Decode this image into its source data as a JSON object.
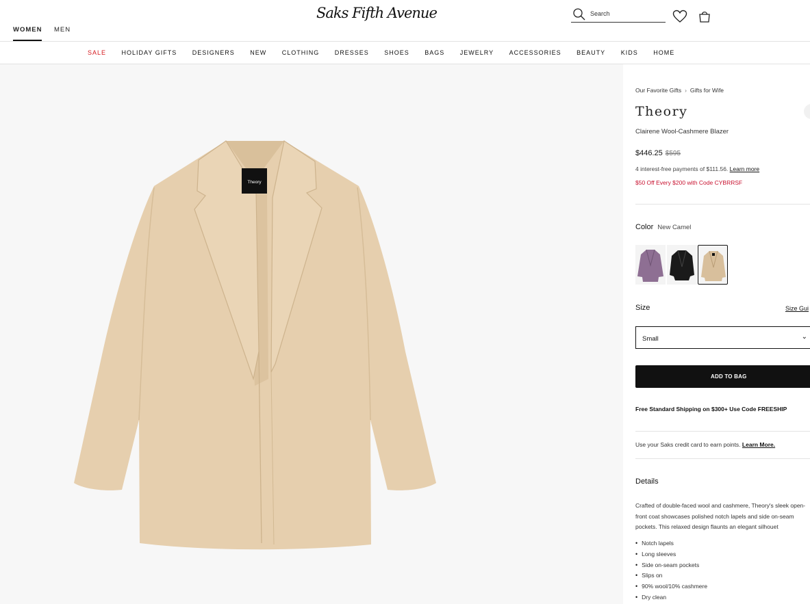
{
  "header": {
    "gender_tabs": [
      "WOMEN",
      "MEN"
    ],
    "logo": "Saks Fifth Avenue",
    "search_placeholder": "Search"
  },
  "nav": {
    "categories": [
      "SALE",
      "HOLIDAY GIFTS",
      "DESIGNERS",
      "NEW",
      "CLOTHING",
      "DRESSES",
      "SHOES",
      "BAGS",
      "JEWELRY",
      "ACCESSORIES",
      "BEAUTY",
      "KIDS",
      "HOME"
    ]
  },
  "gallery": {
    "label_on_garment": "Theory"
  },
  "product": {
    "breadcrumb": [
      "Our Favorite Gifts",
      "Gifts for Wife"
    ],
    "brand": "Theory",
    "name": "Clairene Wool-Cashmere Blazer",
    "price": "$446.25",
    "original_price": "$595",
    "installments_text": "4 interest-free payments of $111.56.",
    "installments_link": "Learn more",
    "promo": "$50 Off Every $200 with Code CYBRRSF",
    "color_label": "Color",
    "color_value": "New Camel",
    "swatch_colors": [
      "#8e6f93",
      "#1a1a1a",
      "#d8bf9c"
    ],
    "size_label": "Size",
    "size_guide": "Size Gui",
    "size_value": "Small",
    "add_to_bag": "ADD TO BAG",
    "shipping": "Free Standard Shipping on $300+ Use Code FREESHIP",
    "credit_text": "Use your Saks credit card to earn points.",
    "credit_link": "Learn More.",
    "details_title": "Details",
    "details_text": "Crafted of double-faced wool and cashmere, Theory's sleek open-front coat showcases polished notch lapels and side on-seam pockets. This relaxed design flaunts an elegant silhouet",
    "details_bullets": [
      "Notch lapels",
      "Long sleeves",
      "Side on-seam pockets",
      "Slips on",
      "90% wool/10% cashmere",
      "Dry clean"
    ]
  },
  "colors": {
    "sale_red": "#d61a1f",
    "promo_red": "#c8102e",
    "camel": "#e6cfae"
  }
}
